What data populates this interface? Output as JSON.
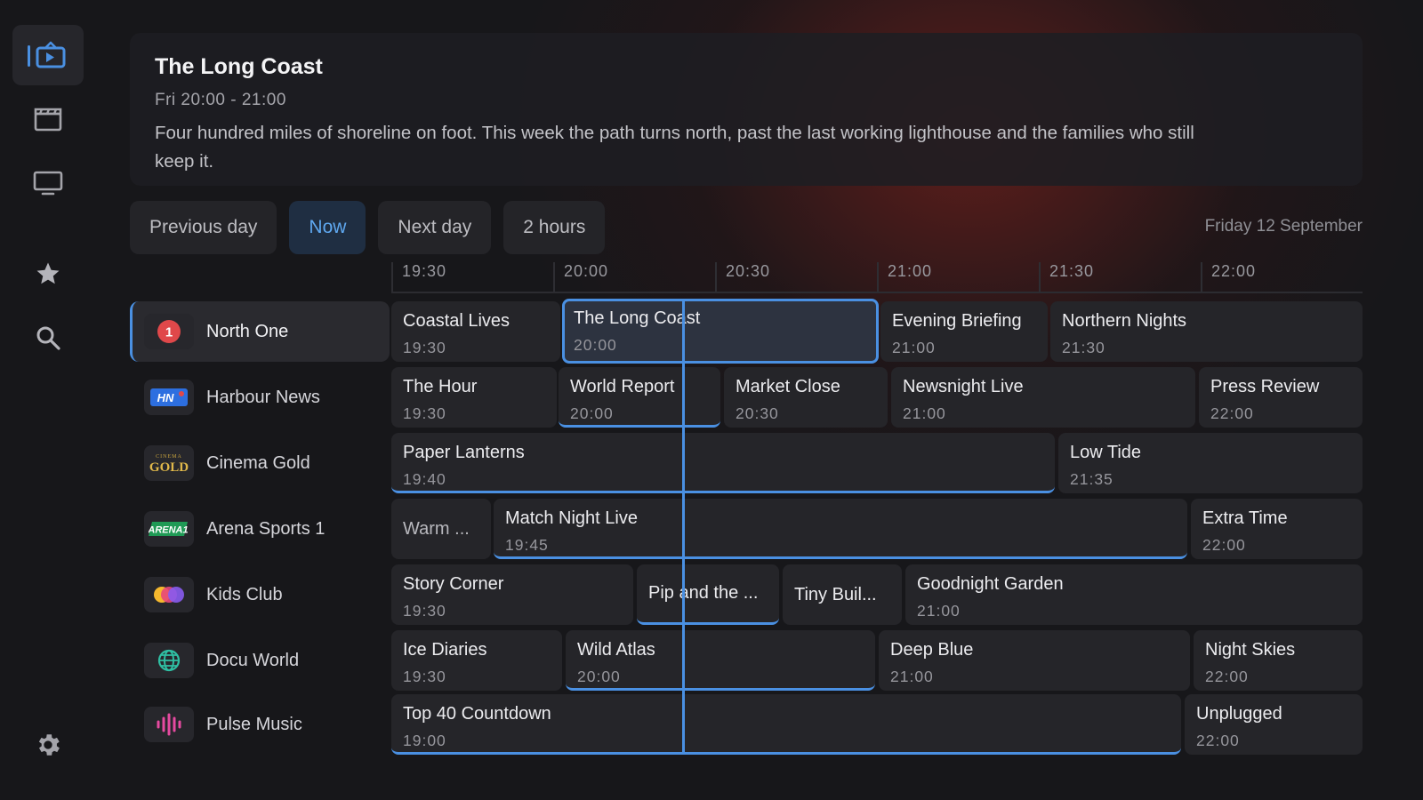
{
  "sidebar": {
    "items": [
      {
        "icon": "live-tv-icon",
        "active": true
      },
      {
        "icon": "movies-icon",
        "active": false
      },
      {
        "icon": "tv-shows-icon",
        "active": false
      },
      {
        "icon": "favorites-star-icon",
        "active": false
      },
      {
        "icon": "search-icon",
        "active": false
      },
      {
        "icon": "settings-gear-icon",
        "active": false
      }
    ]
  },
  "info": {
    "title": "The Long Coast",
    "time": "Fri 20:00 - 21:00",
    "description": "Four hundred miles of shoreline on foot. This week the path turns north, past the last working lighthouse and the families who still keep it."
  },
  "controls": {
    "previous_day": "Previous day",
    "now": "Now",
    "next_day": "Next day",
    "range": "2 hours"
  },
  "date_label": "Friday 12 September",
  "timeline": [
    "19:30",
    "20:00",
    "20:30",
    "21:00",
    "21:30",
    "22:00"
  ],
  "colors": {
    "accent": "#4a90e2",
    "background": "#17171a"
  },
  "channels": [
    {
      "name": "North One",
      "logo": "1"
    },
    {
      "name": "Harbour News",
      "logo": "HN"
    },
    {
      "name": "Cinema Gold",
      "logo_top": "CINEMA",
      "logo": "GOLD"
    },
    {
      "name": "Arena Sports 1",
      "logo": "ARENA1"
    },
    {
      "name": "Kids Club",
      "logo": "kids-club-logo"
    },
    {
      "name": "Docu World",
      "logo": "globe-logo"
    },
    {
      "name": "Pulse Music",
      "logo": "soundwave-logo"
    }
  ],
  "programs": {
    "north_one": [
      {
        "title": "Coastal Lives",
        "time": "19:30"
      },
      {
        "title": "The Long Coast",
        "time": "20:00"
      },
      {
        "title": "Evening Briefing",
        "time": "21:00"
      },
      {
        "title": "Northern Nights",
        "time": "21:30"
      }
    ],
    "harbour_news": [
      {
        "title": "The Hour",
        "time": "19:30"
      },
      {
        "title": "World Report",
        "time": "20:00"
      },
      {
        "title": "Market Close",
        "time": "20:30"
      },
      {
        "title": "Newsnight Live",
        "time": "21:00"
      },
      {
        "title": "Press Review",
        "time": "22:00"
      }
    ],
    "cinema_gold": [
      {
        "title": "Paper Lanterns",
        "time": "19:40"
      },
      {
        "title": "Low Tide",
        "time": "21:35"
      }
    ],
    "arena_sports": [
      {
        "title": "Warm ..."
      },
      {
        "title": "Match Night Live",
        "time": "19:45"
      },
      {
        "title": "Extra Time",
        "time": "22:00"
      }
    ],
    "kids_club": [
      {
        "title": "Story Corner",
        "time": "19:30"
      },
      {
        "title": "Pip and the ..."
      },
      {
        "title": "Tiny Buil..."
      },
      {
        "title": "Goodnight Garden",
        "time": "21:00"
      }
    ],
    "docu_world": [
      {
        "title": "Ice Diaries",
        "time": "19:30"
      },
      {
        "title": "Wild Atlas",
        "time": "20:00"
      },
      {
        "title": "Deep Blue",
        "time": "21:00"
      },
      {
        "title": "Night Skies",
        "time": "22:00"
      }
    ],
    "pulse_music": [
      {
        "title": "Top 40 Countdown",
        "time": "19:00"
      },
      {
        "title": "Unplugged",
        "time": "22:00"
      }
    ]
  }
}
